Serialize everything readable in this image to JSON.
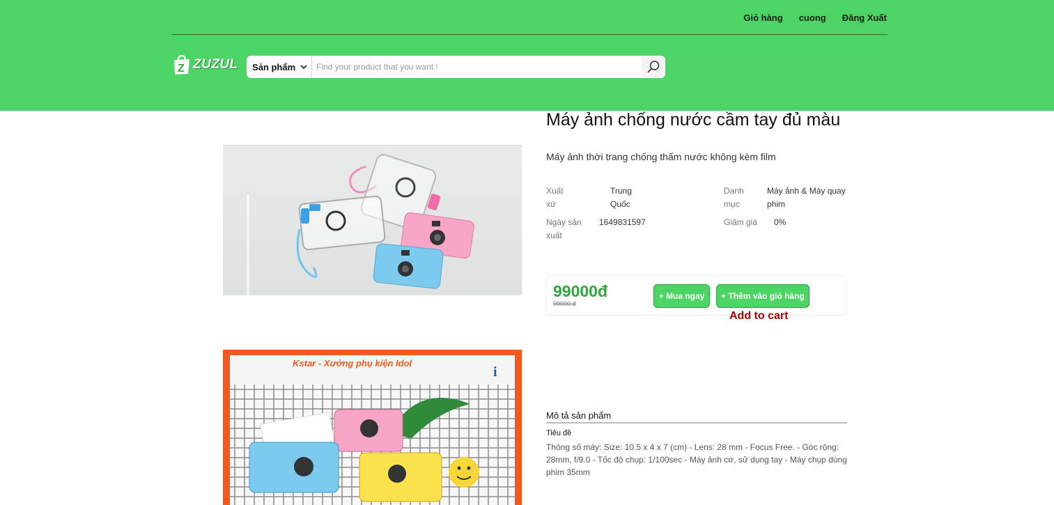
{
  "nav": {
    "cart": "Giỏ hàng",
    "user": "cuong",
    "logout": "Đăng Xuất"
  },
  "logo": {
    "letter": "Z",
    "text": "ZUZUL"
  },
  "search": {
    "category": "Sản phẩm",
    "placeholder": "Find your product that you want !"
  },
  "product": {
    "title": "Máy ảnh chống nước cầm tay đủ màu",
    "subtitle": "Máy ảnh thời trang chống thấm nước không kèm film",
    "attributes": {
      "origin_label_1": "Xuất",
      "origin_label_2": "xứ",
      "origin_value_1": "Trung",
      "origin_value_2": "Quốc",
      "category_label_1": "Danh",
      "category_label_2": "mục",
      "category_value_1": "Máy ảnh & Máy quay",
      "category_value_2": "phim",
      "date_label_1": "Ngày sản",
      "date_label_2": "xuất",
      "date_value": "1649831597",
      "discount_label": "Giảm giá",
      "discount_value": "0%"
    },
    "price": "99000đ",
    "old_price": "99000 đ",
    "buy_label": "+ Mua ngay",
    "cart_label": "+ Thêm vào giỏ hàng",
    "annotation": "Add to cart",
    "image2_banner": "Kstar - Xưởng phụ kiện Idol"
  },
  "description": {
    "heading": "Mô tả sản phẩm",
    "subheading": "Tiêu đề",
    "body": "Thông số máy: Size: 10.5 x 4 x 7 (cm) - Lens: 28 mm - Focus Free. - Góc rộng: 28mm, f/9.0 - Tốc độ chụp: 1/100sec - Máy ảnh cơ, sử dụng tay - Máy chụp dùng phim 35mm"
  },
  "colors": {
    "brand_green": "#4cd464",
    "price_green": "#2aa93a",
    "annotation_red": "#b00000"
  }
}
